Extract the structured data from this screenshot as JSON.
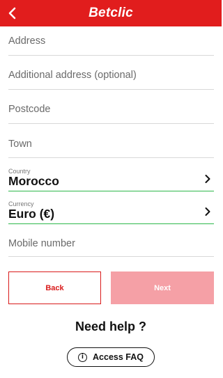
{
  "header": {
    "brand": "Betclic",
    "back_icon": "chevron-left-icon"
  },
  "colors": {
    "brand_red": "#e11d1d",
    "valid_green": "#2db84a",
    "next_disabled": "#f5a0a6"
  },
  "form": {
    "address_placeholder": "Address",
    "additional_address_placeholder": "Additional address (optional)",
    "postcode_placeholder": "Postcode",
    "town_placeholder": "Town",
    "country": {
      "label": "Country",
      "value": "Morocco"
    },
    "currency": {
      "label": "Currency",
      "value": "Euro (€)"
    },
    "mobile_placeholder": "Mobile number"
  },
  "actions": {
    "back_label": "Back",
    "next_label": "Next"
  },
  "help": {
    "title": "Need help ?",
    "faq_label": "Access FAQ",
    "faq_icon_glyph": "i"
  }
}
